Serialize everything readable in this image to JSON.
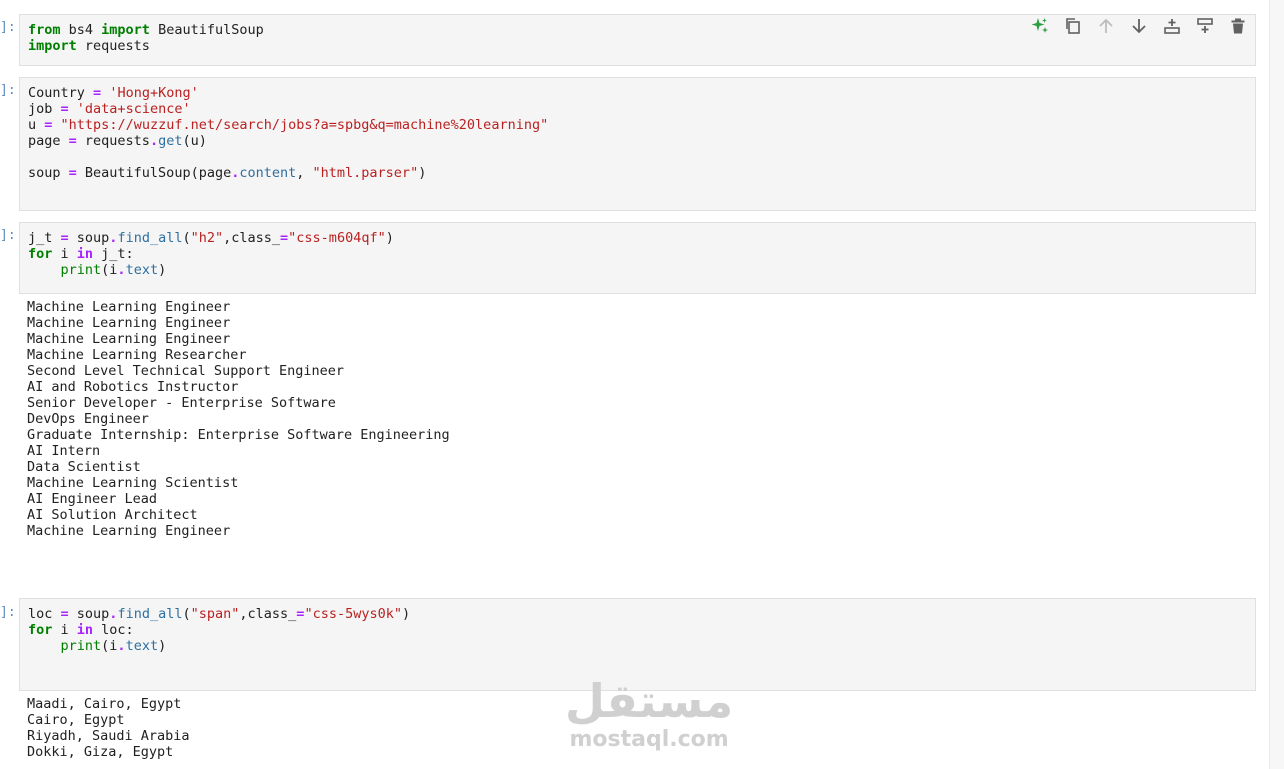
{
  "cells": [
    {
      "prompt": "]:",
      "lines": [
        [
          [
            "kw",
            "from"
          ],
          [
            "t",
            " bs4 "
          ],
          [
            "kw",
            "import"
          ],
          [
            "t",
            " BeautifulSoup"
          ]
        ],
        [
          [
            "kw",
            "import"
          ],
          [
            "t",
            " requests"
          ]
        ]
      ]
    },
    {
      "prompt": "]:",
      "lines": [
        [
          [
            "t",
            "Country "
          ],
          [
            "op",
            "="
          ],
          [
            "t",
            " "
          ],
          [
            "str",
            "'Hong+Kong'"
          ]
        ],
        [
          [
            "t",
            "job "
          ],
          [
            "op",
            "="
          ],
          [
            "t",
            " "
          ],
          [
            "str",
            "'data+science'"
          ]
        ],
        [
          [
            "t",
            "u "
          ],
          [
            "op",
            "="
          ],
          [
            "t",
            " "
          ],
          [
            "str",
            "\"https://wuzzuf.net/search/jobs?a=spbg&q=machine%20learning\""
          ]
        ],
        [
          [
            "t",
            "page "
          ],
          [
            "op",
            "="
          ],
          [
            "t",
            " requests"
          ],
          [
            "op",
            "."
          ],
          [
            "attr",
            "get"
          ],
          [
            "t",
            "(u)"
          ]
        ],
        [
          [
            "t",
            ""
          ]
        ],
        [
          [
            "t",
            "soup "
          ],
          [
            "op",
            "="
          ],
          [
            "t",
            " BeautifulSoup(page"
          ],
          [
            "op",
            "."
          ],
          [
            "attr",
            "content"
          ],
          [
            "t",
            ", "
          ],
          [
            "str",
            "\"html.parser\""
          ],
          [
            "t",
            ")"
          ]
        ]
      ]
    },
    {
      "prompt": "]:",
      "lines": [
        [
          [
            "t",
            "j_t "
          ],
          [
            "op",
            "="
          ],
          [
            "t",
            " soup"
          ],
          [
            "op",
            "."
          ],
          [
            "attr",
            "find_all"
          ],
          [
            "t",
            "("
          ],
          [
            "str",
            "\"h2\""
          ],
          [
            "t",
            ",class_"
          ],
          [
            "op",
            "="
          ],
          [
            "str",
            "\"css-m604qf\""
          ],
          [
            "t",
            ")"
          ]
        ],
        [
          [
            "kw",
            "for"
          ],
          [
            "t",
            " i "
          ],
          [
            "op",
            "in"
          ],
          [
            "t",
            " j_t:"
          ]
        ],
        [
          [
            "t",
            "    "
          ],
          [
            "fn",
            "print"
          ],
          [
            "t",
            "(i"
          ],
          [
            "op",
            "."
          ],
          [
            "attr",
            "text"
          ],
          [
            "t",
            ")"
          ]
        ]
      ]
    },
    {
      "prompt": "]:",
      "lines": [
        [
          [
            "t",
            "loc "
          ],
          [
            "op",
            "="
          ],
          [
            "t",
            " soup"
          ],
          [
            "op",
            "."
          ],
          [
            "attr",
            "find_all"
          ],
          [
            "t",
            "("
          ],
          [
            "str",
            "\"span\""
          ],
          [
            "t",
            ",class_"
          ],
          [
            "op",
            "="
          ],
          [
            "str",
            "\"css-5wys0k\""
          ],
          [
            "t",
            ")"
          ]
        ],
        [
          [
            "kw",
            "for"
          ],
          [
            "t",
            " i "
          ],
          [
            "op",
            "in"
          ],
          [
            "t",
            " loc:"
          ]
        ],
        [
          [
            "t",
            "    "
          ],
          [
            "fn",
            "print"
          ],
          [
            "t",
            "(i"
          ],
          [
            "op",
            "."
          ],
          [
            "attr",
            "text"
          ],
          [
            "t",
            ")"
          ]
        ]
      ]
    }
  ],
  "outputs": {
    "job_titles": [
      "Machine Learning Engineer",
      "Machine Learning Engineer",
      "Machine Learning Engineer",
      "Machine Learning Researcher",
      "Second Level Technical Support Engineer",
      "AI and Robotics Instructor",
      "Senior Developer - Enterprise Software",
      "DevOps Engineer",
      "Graduate Internship: Enterprise Software Engineering",
      "AI Intern",
      "Data Scientist",
      "Machine Learning Scientist",
      "AI Engineer Lead",
      "AI Solution Architect",
      "Machine Learning Engineer"
    ],
    "locations": [
      "Maadi, Cairo, Egypt",
      "Cairo, Egypt",
      "Riyadh, Saudi Arabia",
      "Dokki, Giza, Egypt"
    ]
  },
  "toolbar": [
    "sparkle-icon",
    "duplicate-icon",
    "move-up-icon",
    "move-down-icon",
    "insert-above-icon",
    "insert-below-icon",
    "delete-icon"
  ],
  "watermark": {
    "arabic": "مستقل",
    "latin": "mostaql.com"
  },
  "colors": {
    "keyword": "#008000",
    "operator": "#aa22ff",
    "string": "#ba2121",
    "attribute": "#2f6f9f"
  }
}
